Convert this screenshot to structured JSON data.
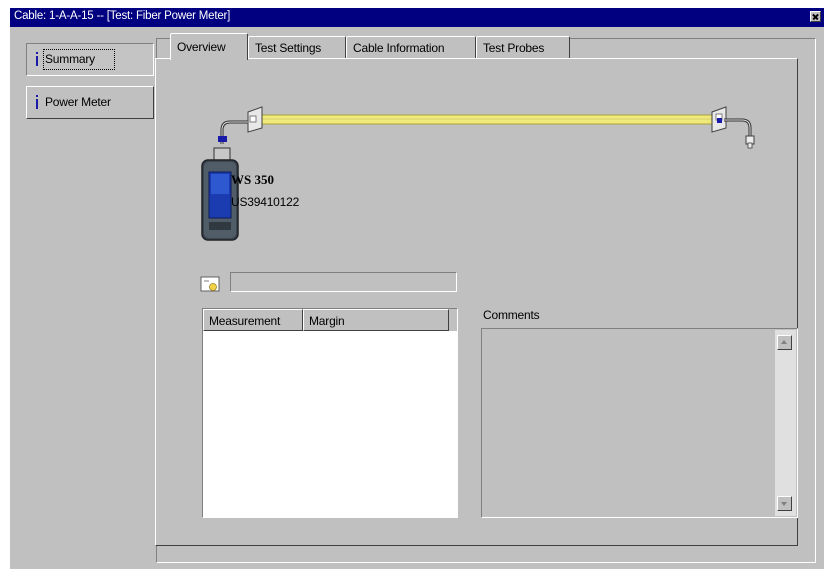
{
  "window": {
    "title": "Cable: 1-A-A-15 -- [Test: Fiber Power Meter]"
  },
  "sidebar": {
    "items": [
      {
        "label": "Summary"
      },
      {
        "label": "Power Meter"
      }
    ]
  },
  "tabs": [
    {
      "label": "Overview"
    },
    {
      "label": "Test Settings"
    },
    {
      "label": "Cable Information"
    },
    {
      "label": "Test Probes"
    }
  ],
  "device": {
    "model": "WS 350",
    "serial": "US39410122"
  },
  "table": {
    "columns": [
      "Measurement",
      "Margin"
    ],
    "rows": []
  },
  "comments": {
    "label": "Comments",
    "value": ""
  },
  "colors": {
    "titlebar": "#000080",
    "cable": "#f0ea7a",
    "connector": "#1a1aa8"
  },
  "icons": {
    "info": "info-icon",
    "progress": "test-status-icon",
    "close": "close-icon"
  }
}
